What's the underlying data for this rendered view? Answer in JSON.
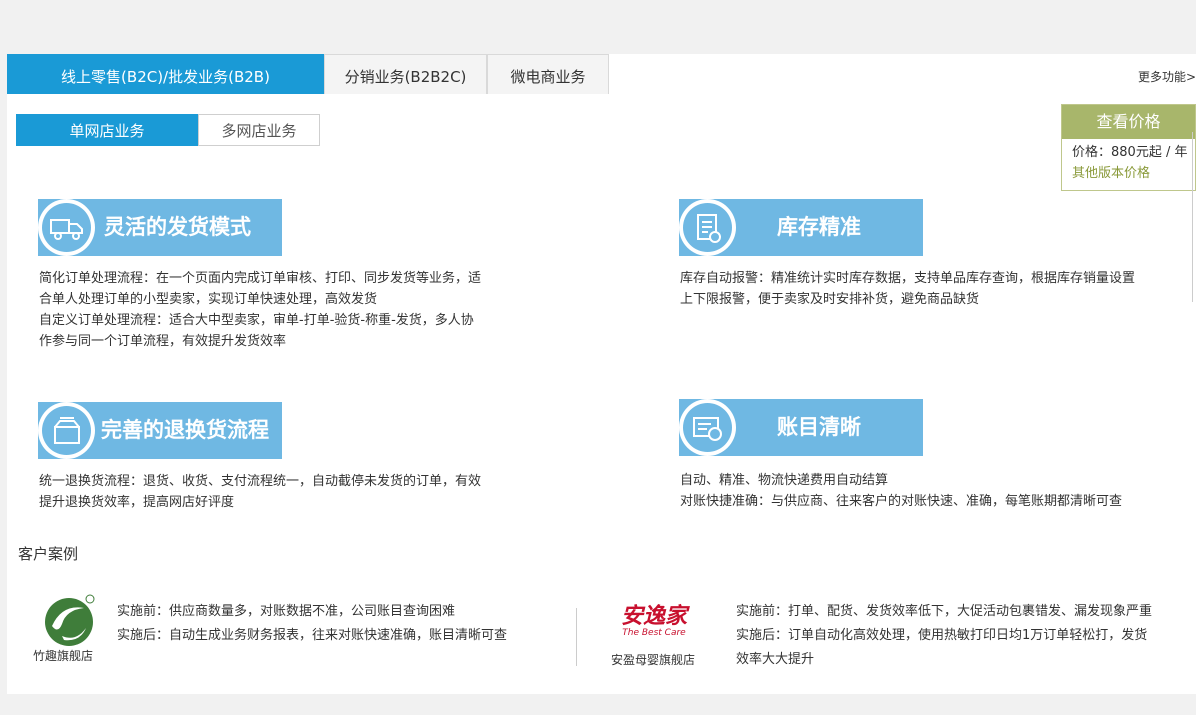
{
  "tabs": [
    {
      "label": "线上零售(B2C)/批发业务(B2B)"
    },
    {
      "label": "分销业务(B2B2C)"
    },
    {
      "label": "微电商业务"
    }
  ],
  "more_label": "更多功能>",
  "subtabs": [
    {
      "label": "单网店业务"
    },
    {
      "label": "多网店业务"
    }
  ],
  "price": {
    "button": "查看价格",
    "line": "价格：880元起 / 年",
    "link": "其他版本价格"
  },
  "features": [
    {
      "title": "灵活的发货模式",
      "icon": "truck-icon",
      "lines": [
        "简化订单处理流程：在一个页面内完成订单审核、打印、同步发货等业务，适",
        "合单人处理订单的小型卖家，实现订单快速处理，高效发货",
        "自定义订单处理流程：适合大中型卖家，审单-打单-验货-称重-发货，多人协",
        "作参与同一个订单流程，有效提升发货效率"
      ]
    },
    {
      "title": "库存精准",
      "icon": "inventory-list-icon",
      "lines": [
        "库存自动报警：精准统计实时库存数据，支持单品库存查询，根据库存销量设置",
        "上下限报警，便于卖家及时安排补货，避免商品缺货"
      ]
    },
    {
      "title": "完善的退换货流程",
      "icon": "return-box-icon",
      "lines": [
        "统一退换货流程：退货、收货、支付流程统一，自动截停未发货的订单，有效",
        "提升退换货效率，提高网店好评度"
      ]
    },
    {
      "title": "账目清晰",
      "icon": "accounting-icon",
      "lines": [
        "自动、精准、物流快递费用自动结算",
        "对账快捷准确：与供应商、往来客户的对账快速、准确，每笔账期都清晰可查"
      ]
    }
  ],
  "cases": {
    "title": "客户案例",
    "items": [
      {
        "logo_caption": "竹趣旗舰店",
        "lines": [
          "实施前：供应商数量多，对账数据不准，公司账目查询困难",
          "实施后：自动生成业务财务报表，往来对账快速准确，账目清晰可查"
        ]
      },
      {
        "logo_caption": "安盈母婴旗舰店",
        "logo_text": "安逸家",
        "logo_sub": "The Best Care",
        "lines": [
          "实施前：打单、配货、发货效率低下，大促活动包裹错发、漏发现象严重",
          "实施后：订单自动化高效处理，使用热敏打印日均1万订单轻松打，发货",
          "效率大大提升"
        ]
      }
    ]
  },
  "colors": {
    "tab_active": "#1a9ad6",
    "banner": "#6fb8e3",
    "price_head": "#a8b66b",
    "price_link": "#8a9a3a",
    "logo_red": "#c8102e",
    "logo_green": "#3f7d3a"
  }
}
